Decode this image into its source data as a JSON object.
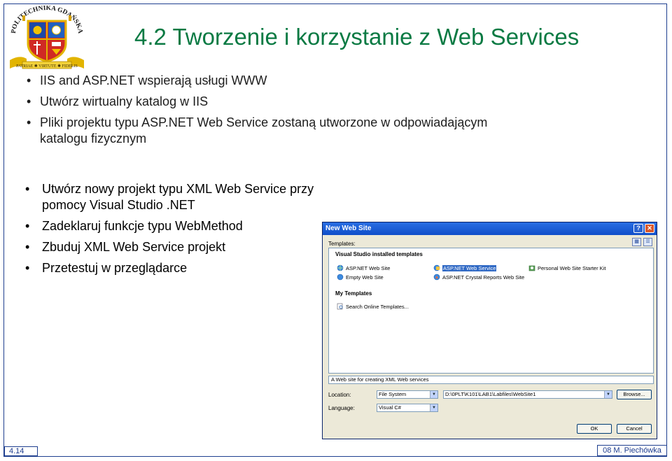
{
  "slide": {
    "title": "4.2 Tworzenie i korzystanie z Web Services",
    "logo_text": "POLITECHNIKA GDAŃSKA",
    "logo_motto": "PATRIAE ✱ VIRTUTE ✱ FIDELIS",
    "top_bullets": [
      "IIS and ASP.NET wspierają usługi WWW",
      "Utwórz wirtualny katalog w IIS",
      "Pliki projektu typu ASP.NET Web Service  zostaną utworzone w odpowiadającym katalogu fizycznym"
    ],
    "bullets": [
      "Utwórz nowy projekt typu XML Web Service przy pomocy Visual Studio .NET",
      "Zadeklaruj funkcje typu WebMethod",
      "Zbuduj XML Web Service projekt",
      "Przetestuj w przeglądarce"
    ],
    "footer_left": "4.14",
    "footer_right": "08 M. Piechówka"
  },
  "dialog": {
    "title": "New Web Site",
    "help_btn": "?",
    "close_btn": "✕",
    "templates_label": "Templates:",
    "section_installed": "Visual Studio installed templates",
    "templates": [
      {
        "label": "ASP.NET Web Site"
      },
      {
        "label": "ASP.NET Web Service"
      },
      {
        "label": "Personal Web Site Starter Kit"
      },
      {
        "label": "Empty Web Site"
      },
      {
        "label": "ASP.NET Crystal Reports Web Site"
      }
    ],
    "section_my": "My Templates",
    "search_online": "Search Online Templates...",
    "description": "A Web site for creating XML Web services",
    "location_label": "Location:",
    "location_type": "File System",
    "location_path": "D:\\0PLT\\K101\\LAB1\\Labfiles\\WebSite1",
    "browse_btn": "Browse...",
    "language_label": "Language:",
    "language_value": "Visual C#",
    "ok_btn": "OK",
    "cancel_btn": "Cancel"
  },
  "colors": {
    "title_green": "#0a7a43",
    "frame_blue": "#1f3f8f",
    "xp_blue": "#0f4ec9",
    "selection": "#316ac5"
  }
}
